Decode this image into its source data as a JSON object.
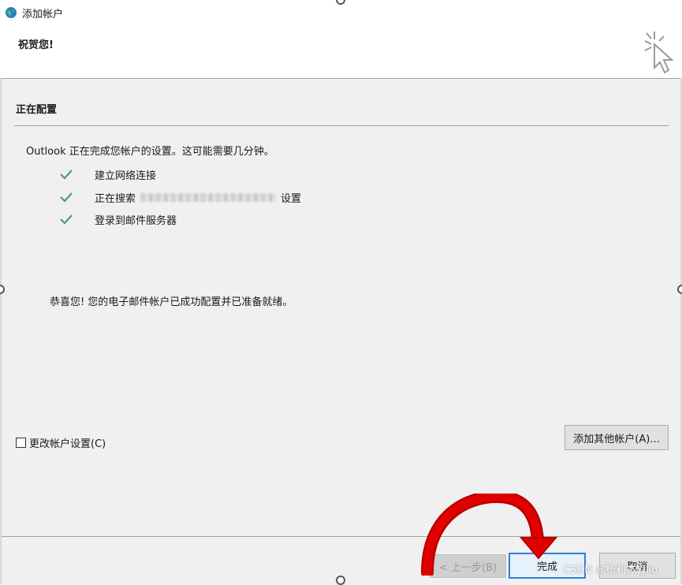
{
  "window": {
    "title": "添加帐户"
  },
  "header": {
    "title": "祝贺您!"
  },
  "main": {
    "section_title": "正在配置",
    "status_line": "Outlook 正在完成您帐户的设置。这可能需要几分钟。",
    "steps": [
      {
        "label": "建立网络连接",
        "icon": "check-icon"
      },
      {
        "label_prefix": "正在搜索",
        "label_suffix": "设置",
        "icon": "check-icon"
      },
      {
        "label": "登录到邮件服务器",
        "icon": "check-icon"
      }
    ],
    "congrats": "恭喜您! 您的电子邮件帐户已成功配置并已准备就绪。",
    "change_settings_label": "更改帐户设置(C)",
    "change_settings_checked": false,
    "add_other_label": "添加其他帐户(A)..."
  },
  "footer": {
    "back_label": "< 上一步(B)",
    "finish_label": "完成",
    "cancel_label": "取消"
  },
  "watermark": "CSDN @杨利杰YJlio",
  "colors": {
    "check": "#4a9a7a",
    "annotation_arrow": "#e00000",
    "focus_border": "#2f7fd4"
  }
}
